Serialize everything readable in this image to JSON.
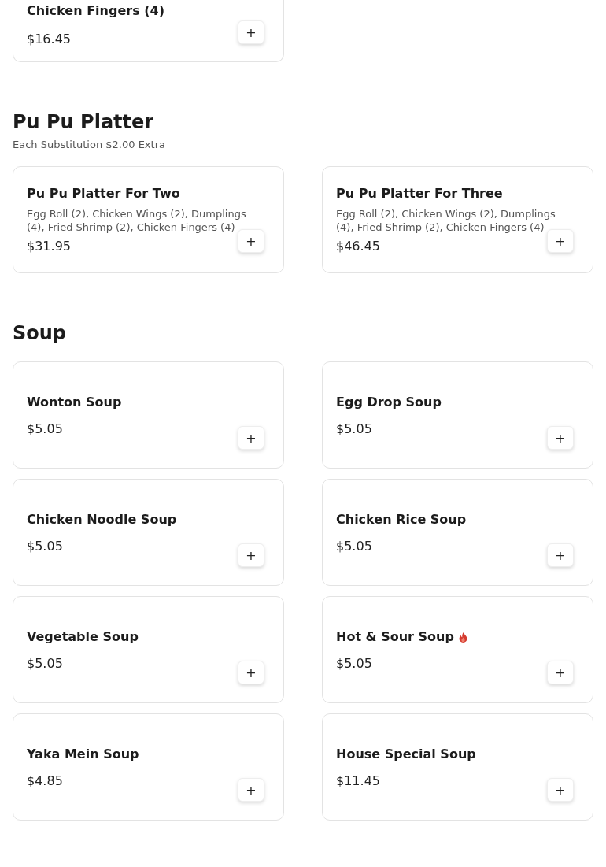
{
  "sections": [
    {
      "kind": "continued",
      "items": [
        {
          "title": "Chicken Fingers (4)",
          "price": "$16.45",
          "add_label": "+"
        }
      ]
    },
    {
      "kind": "platter",
      "heading": "Pu Pu Platter",
      "note": "Each Substitution $2.00 Extra",
      "items": [
        {
          "title": "Pu Pu Platter For Two",
          "description": "Egg Roll (2), Chicken Wings (2), Dumplings (4), Fried Shrimp (2), Chicken Fingers (4)",
          "price": "$31.95",
          "add_label": "+"
        },
        {
          "title": "Pu Pu Platter For Three",
          "description": "Egg Roll (2), Chicken Wings (2), Dumplings (4), Fried Shrimp (2), Chicken Fingers (4)",
          "price": "$46.45",
          "add_label": "+"
        }
      ]
    },
    {
      "kind": "soup",
      "heading": "Soup",
      "items": [
        {
          "title": "Wonton Soup",
          "spicy": false,
          "price": "$5.05",
          "add_label": "+"
        },
        {
          "title": "Egg Drop Soup",
          "spicy": false,
          "price": "$5.05",
          "add_label": "+"
        },
        {
          "title": "Chicken Noodle Soup",
          "spicy": false,
          "price": "$5.05",
          "add_label": "+"
        },
        {
          "title": "Chicken Rice Soup",
          "spicy": false,
          "price": "$5.05",
          "add_label": "+"
        },
        {
          "title": "Vegetable Soup",
          "spicy": false,
          "price": "$5.05",
          "add_label": "+"
        },
        {
          "title": "Hot & Sour Soup",
          "spicy": true,
          "price": "$5.05",
          "add_label": "+"
        },
        {
          "title": "Yaka Mein Soup",
          "spicy": false,
          "price": "$4.85",
          "add_label": "+"
        },
        {
          "title": "House Special Soup",
          "spicy": false,
          "price": "$11.45",
          "add_label": "+"
        }
      ]
    }
  ]
}
